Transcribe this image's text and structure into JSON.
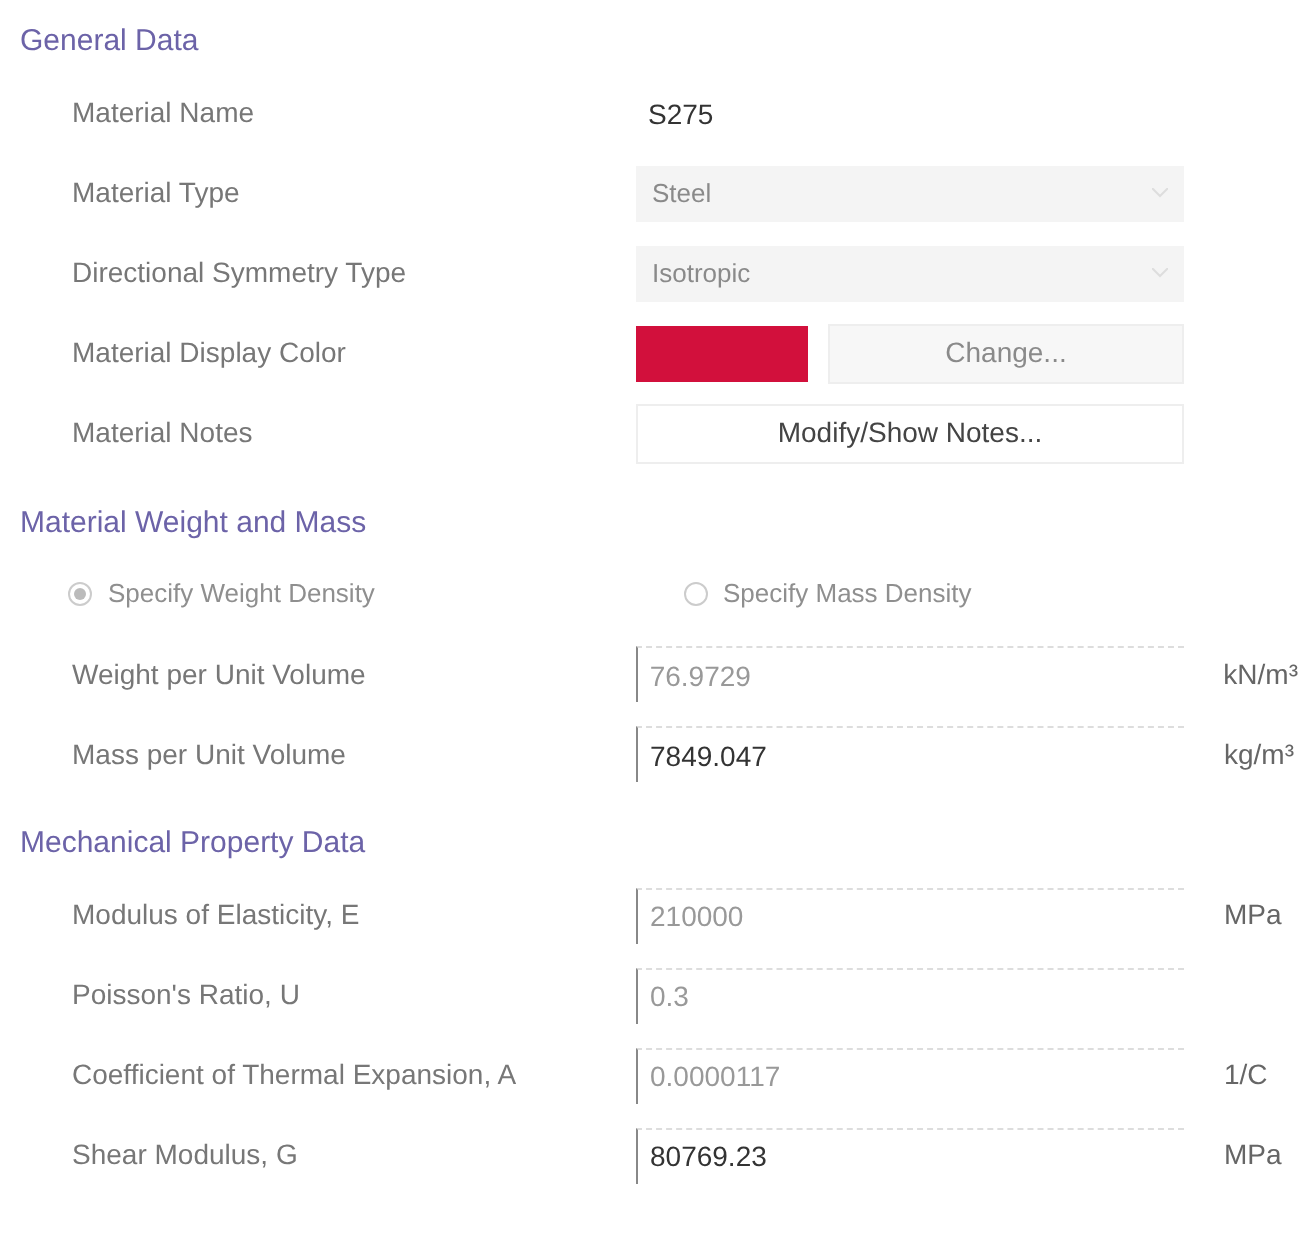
{
  "sections": [
    {
      "title": "General Data",
      "rows": [
        {
          "kind": "text",
          "label": "Material Name",
          "value": "S275"
        },
        {
          "kind": "select",
          "label": "Material Type",
          "value": "Steel",
          "disabled": true
        },
        {
          "kind": "select",
          "label": "Directional Symmetry Type",
          "value": "Isotropic",
          "disabled": true
        },
        {
          "kind": "color",
          "label": "Material Display Color",
          "color": "#d2103c",
          "button": "Change...",
          "disabled": true
        },
        {
          "kind": "button",
          "label": "Material Notes",
          "button": "Modify/Show Notes...",
          "disabled": false
        }
      ]
    },
    {
      "title": "Material Weight and Mass",
      "rows": [
        {
          "kind": "radios",
          "disabled": true,
          "options": [
            {
              "label": "Specify Weight Density",
              "selected": true
            },
            {
              "label": "Specify Mass Density",
              "selected": false
            }
          ]
        },
        {
          "kind": "number",
          "label": "Weight per Unit Volume",
          "value": "76.9729",
          "unit": "kN/m³",
          "disabled": true
        },
        {
          "kind": "number",
          "label": "Mass per Unit Volume",
          "value": "7849.047",
          "unit": "kg/m³",
          "disabled": false
        }
      ]
    },
    {
      "title": "Mechanical Property Data",
      "rows": [
        {
          "kind": "number",
          "label": "Modulus of Elasticity,  E",
          "value": "210000",
          "unit": "MPa",
          "disabled": true
        },
        {
          "kind": "number",
          "label": "Poisson's Ratio,  U",
          "value": "0.3",
          "disabled": true
        },
        {
          "kind": "number",
          "label": "Coefficient of Thermal Expansion,  A",
          "value": "0.0000117",
          "unit": "1/C",
          "disabled": true
        },
        {
          "kind": "number",
          "label": "Shear Modulus,  G",
          "value": "80769.23",
          "unit": "MPa",
          "disabled": false
        }
      ]
    }
  ]
}
